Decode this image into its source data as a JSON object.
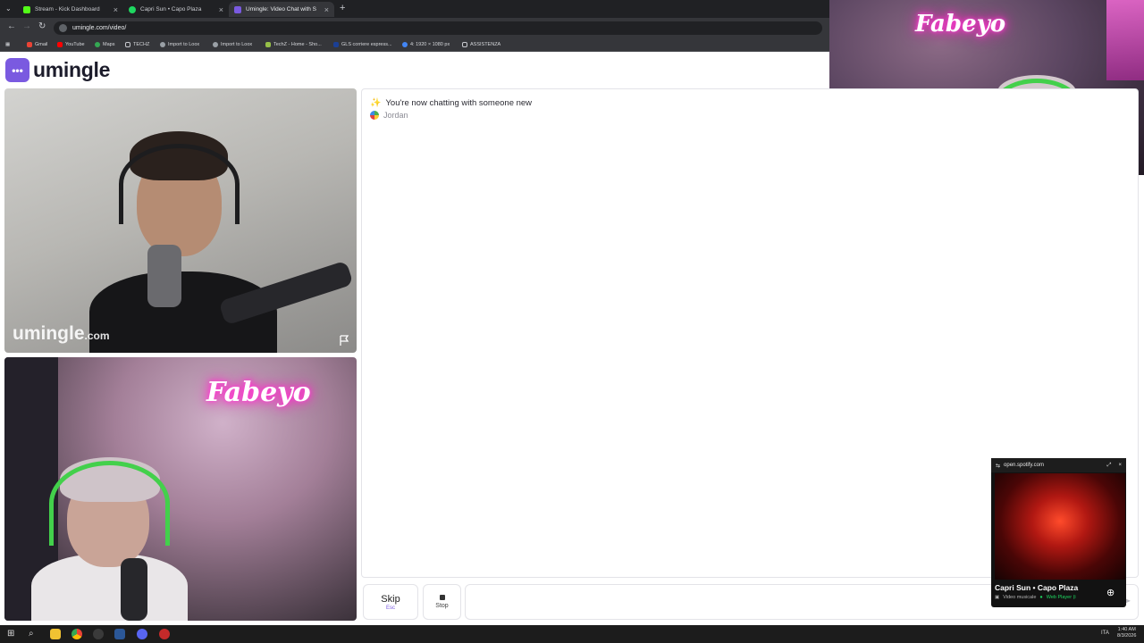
{
  "browser": {
    "tabs": [
      {
        "label": "Stream - Kick Dashboard",
        "active": false
      },
      {
        "label": "Capri Sun • Capo Plaza",
        "active": false
      },
      {
        "label": "Umingle: Video Chat with S",
        "active": true
      }
    ],
    "new_tab_symbol": "+",
    "url": "umingle.com/video/",
    "bookmarks": [
      "Gmail",
      "YouTube",
      "Maps",
      "TECHZ",
      "Import to Loox",
      "Import to Loox",
      "TechZ - Home - Sho...",
      "GLS corriere espress...",
      "4: 1920 × 1080 px",
      "ASSISTENZA"
    ]
  },
  "site": {
    "logo_text": "umingle",
    "watermark_main": "umingle",
    "watermark_suffix": ".com"
  },
  "overlay": {
    "neon_sign_text": "Fabeyo"
  },
  "chat": {
    "status_message": "You're now chatting with someone new",
    "partner_name": "Jordan",
    "input_value": ""
  },
  "controls": {
    "skip_label": "Skip",
    "skip_hint": "Esc",
    "stop_label": "Stop"
  },
  "spotify": {
    "domain": "open.spotify.com",
    "track_title": "Capri Sun • Capo Plaza",
    "subtitle": "Video musicale",
    "player_label": "Web Player (i"
  },
  "taskbar": {
    "language": "ITA",
    "time": "1:40 AM",
    "date": "8/3/2026"
  },
  "colors": {
    "brand": "#7a5ae0",
    "spotify_green": "#1ed760"
  }
}
